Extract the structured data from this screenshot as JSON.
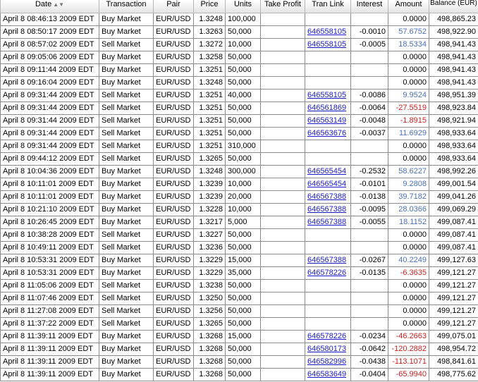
{
  "columns": [
    "Date",
    "Transaction",
    "Pair",
    "Price",
    "Units",
    "Take Profit",
    "Tran Link",
    "Interest",
    "Amount",
    "Balance (EUR)"
  ],
  "sort_icon": "sort-arrows-icon",
  "colors": {
    "positive_amount": "#4a6fbf",
    "negative_amount": "#d12020",
    "link": "#1a1acb"
  },
  "rows": [
    {
      "date": "April 8 08:46:13 2009 EDT",
      "tran": "Buy Market",
      "pair": "EUR/USD",
      "price": "1.3248",
      "units": "100,000",
      "tp": "",
      "link": "",
      "interest": "",
      "amount": "0.0000",
      "balance": "498,865.23",
      "sign": ""
    },
    {
      "date": "April 8 08:50:17 2009 EDT",
      "tran": "Buy Market",
      "pair": "EUR/USD",
      "price": "1.3263",
      "units": "50,000",
      "tp": "",
      "link": "646558105",
      "interest": "-0.0010",
      "amount": "57.6752",
      "balance": "498,922.90",
      "sign": "pos"
    },
    {
      "date": "April 8 08:57:02 2009 EDT",
      "tran": "Sell Market",
      "pair": "EUR/USD",
      "price": "1.3272",
      "units": "10,000",
      "tp": "",
      "link": "646558105",
      "interest": "-0.0005",
      "amount": "18.5334",
      "balance": "498,941.43",
      "sign": "pos"
    },
    {
      "date": "April 8 09:05:06 2009 EDT",
      "tran": "Buy Market",
      "pair": "EUR/USD",
      "price": "1.3258",
      "units": "50,000",
      "tp": "",
      "link": "",
      "interest": "",
      "amount": "0.0000",
      "balance": "498,941.43",
      "sign": ""
    },
    {
      "date": "April 8 09:11:44 2009 EDT",
      "tran": "Buy Market",
      "pair": "EUR/USD",
      "price": "1.3251",
      "units": "50,000",
      "tp": "",
      "link": "",
      "interest": "",
      "amount": "0.0000",
      "balance": "498,941.43",
      "sign": ""
    },
    {
      "date": "April 8 09:16:04 2009 EDT",
      "tran": "Buy Market",
      "pair": "EUR/USD",
      "price": "1.3248",
      "units": "50,000",
      "tp": "",
      "link": "",
      "interest": "",
      "amount": "0.0000",
      "balance": "498,941.43",
      "sign": ""
    },
    {
      "date": "April 8 09:31:44 2009 EDT",
      "tran": "Sell Market",
      "pair": "EUR/USD",
      "price": "1.3251",
      "units": "40,000",
      "tp": "",
      "link": "646558105",
      "interest": "-0.0086",
      "amount": "9.9524",
      "balance": "498,951.39",
      "sign": "pos"
    },
    {
      "date": "April 8 09:31:44 2009 EDT",
      "tran": "Sell Market",
      "pair": "EUR/USD",
      "price": "1.3251",
      "units": "50,000",
      "tp": "",
      "link": "646561869",
      "interest": "-0.0064",
      "amount": "-27.5519",
      "balance": "498,923.84",
      "sign": "neg"
    },
    {
      "date": "April 8 09:31:44 2009 EDT",
      "tran": "Sell Market",
      "pair": "EUR/USD",
      "price": "1.3251",
      "units": "50,000",
      "tp": "",
      "link": "646563149",
      "interest": "-0.0048",
      "amount": "-1.8915",
      "balance": "498,921.94",
      "sign": "neg"
    },
    {
      "date": "April 8 09:31:44 2009 EDT",
      "tran": "Sell Market",
      "pair": "EUR/USD",
      "price": "1.3251",
      "units": "50,000",
      "tp": "",
      "link": "646563676",
      "interest": "-0.0037",
      "amount": "11.6929",
      "balance": "498,933.64",
      "sign": "pos"
    },
    {
      "date": "April 8 09:31:44 2009 EDT",
      "tran": "Sell Market",
      "pair": "EUR/USD",
      "price": "1.3251",
      "units": "310,000",
      "tp": "",
      "link": "",
      "interest": "",
      "amount": "0.0000",
      "balance": "498,933.64",
      "sign": ""
    },
    {
      "date": "April 8 09:44:12 2009 EDT",
      "tran": "Sell Market",
      "pair": "EUR/USD",
      "price": "1.3265",
      "units": "50,000",
      "tp": "",
      "link": "",
      "interest": "",
      "amount": "0.0000",
      "balance": "498,933.64",
      "sign": ""
    },
    {
      "date": "April 8 10:04:36 2009 EDT",
      "tran": "Buy Market",
      "pair": "EUR/USD",
      "price": "1.3248",
      "units": "300,000",
      "tp": "",
      "link": "646565454",
      "interest": "-0.2532",
      "amount": "58.6227",
      "balance": "498,992.26",
      "sign": "pos"
    },
    {
      "date": "April 8 10:11:01 2009 EDT",
      "tran": "Buy Market",
      "pair": "EUR/USD",
      "price": "1.3239",
      "units": "10,000",
      "tp": "",
      "link": "646565454",
      "interest": "-0.0101",
      "amount": "9.2808",
      "balance": "499,001.54",
      "sign": "pos"
    },
    {
      "date": "April 8 10:11:01 2009 EDT",
      "tran": "Buy Market",
      "pair": "EUR/USD",
      "price": "1.3239",
      "units": "20,000",
      "tp": "",
      "link": "646567388",
      "interest": "-0.0138",
      "amount": "39.7182",
      "balance": "499,041.26",
      "sign": "pos"
    },
    {
      "date": "April 8 10:21:10 2009 EDT",
      "tran": "Buy Market",
      "pair": "EUR/USD",
      "price": "1.3228",
      "units": "10,000",
      "tp": "",
      "link": "646567388",
      "interest": "-0.0095",
      "amount": "28.0366",
      "balance": "499,069.29",
      "sign": "pos"
    },
    {
      "date": "April 8 10:26:45 2009 EDT",
      "tran": "Buy Market",
      "pair": "EUR/USD",
      "price": "1.3217",
      "units": "5,000",
      "tp": "",
      "link": "646567388",
      "interest": "-0.0055",
      "amount": "18.1152",
      "balance": "499,087.41",
      "sign": "pos"
    },
    {
      "date": "April 8 10:38:28 2009 EDT",
      "tran": "Sell Market",
      "pair": "EUR/USD",
      "price": "1.3227",
      "units": "50,000",
      "tp": "",
      "link": "",
      "interest": "",
      "amount": "0.0000",
      "balance": "499,087.41",
      "sign": ""
    },
    {
      "date": "April 8 10:49:11 2009 EDT",
      "tran": "Sell Market",
      "pair": "EUR/USD",
      "price": "1.3236",
      "units": "50,000",
      "tp": "",
      "link": "",
      "interest": "",
      "amount": "0.0000",
      "balance": "499,087.41",
      "sign": ""
    },
    {
      "date": "April 8 10:53:31 2009 EDT",
      "tran": "Buy Market",
      "pair": "EUR/USD",
      "price": "1.3229",
      "units": "15,000",
      "tp": "",
      "link": "646567388",
      "interest": "-0.0267",
      "amount": "40.2249",
      "balance": "499,127.63",
      "sign": "pos"
    },
    {
      "date": "April 8 10:53:31 2009 EDT",
      "tran": "Buy Market",
      "pair": "EUR/USD",
      "price": "1.3229",
      "units": "35,000",
      "tp": "",
      "link": "646578226",
      "interest": "-0.0135",
      "amount": "-6.3635",
      "balance": "499,121.27",
      "sign": "neg"
    },
    {
      "date": "April 8 11:05:06 2009 EDT",
      "tran": "Sell Market",
      "pair": "EUR/USD",
      "price": "1.3238",
      "units": "50,000",
      "tp": "",
      "link": "",
      "interest": "",
      "amount": "0.0000",
      "balance": "499,121.27",
      "sign": ""
    },
    {
      "date": "April 8 11:07:46 2009 EDT",
      "tran": "Sell Market",
      "pair": "EUR/USD",
      "price": "1.3250",
      "units": "50,000",
      "tp": "",
      "link": "",
      "interest": "",
      "amount": "0.0000",
      "balance": "499,121.27",
      "sign": ""
    },
    {
      "date": "April 8 11:27:08 2009 EDT",
      "tran": "Sell Market",
      "pair": "EUR/USD",
      "price": "1.3256",
      "units": "50,000",
      "tp": "",
      "link": "",
      "interest": "",
      "amount": "0.0000",
      "balance": "499,121.27",
      "sign": ""
    },
    {
      "date": "April 8 11:37:22 2009 EDT",
      "tran": "Sell Market",
      "pair": "EUR/USD",
      "price": "1.3265",
      "units": "50,000",
      "tp": "",
      "link": "",
      "interest": "",
      "amount": "0.0000",
      "balance": "499,121.27",
      "sign": ""
    },
    {
      "date": "April 8 11:39:11 2009 EDT",
      "tran": "Buy Market",
      "pair": "EUR/USD",
      "price": "1.3268",
      "units": "15,000",
      "tp": "",
      "link": "646578226",
      "interest": "-0.0234",
      "amount": "-46.2663",
      "balance": "499,075.01",
      "sign": "neg"
    },
    {
      "date": "April 8 11:39:11 2009 EDT",
      "tran": "Buy Market",
      "pair": "EUR/USD",
      "price": "1.3268",
      "units": "50,000",
      "tp": "",
      "link": "646580173",
      "interest": "-0.0642",
      "amount": "-120.2882",
      "balance": "498,954.72",
      "sign": "neg"
    },
    {
      "date": "April 8 11:39:11 2009 EDT",
      "tran": "Buy Market",
      "pair": "EUR/USD",
      "price": "1.3268",
      "units": "50,000",
      "tp": "",
      "link": "646582996",
      "interest": "-0.0438",
      "amount": "-113.1071",
      "balance": "498,841.61",
      "sign": "neg"
    },
    {
      "date": "April 8 11:39:11 2009 EDT",
      "tran": "Buy Market",
      "pair": "EUR/USD",
      "price": "1.3268",
      "units": "50,000",
      "tp": "",
      "link": "646583649",
      "interest": "-0.0404",
      "amount": "-65.9940",
      "balance": "498,775.62",
      "sign": "neg"
    }
  ]
}
